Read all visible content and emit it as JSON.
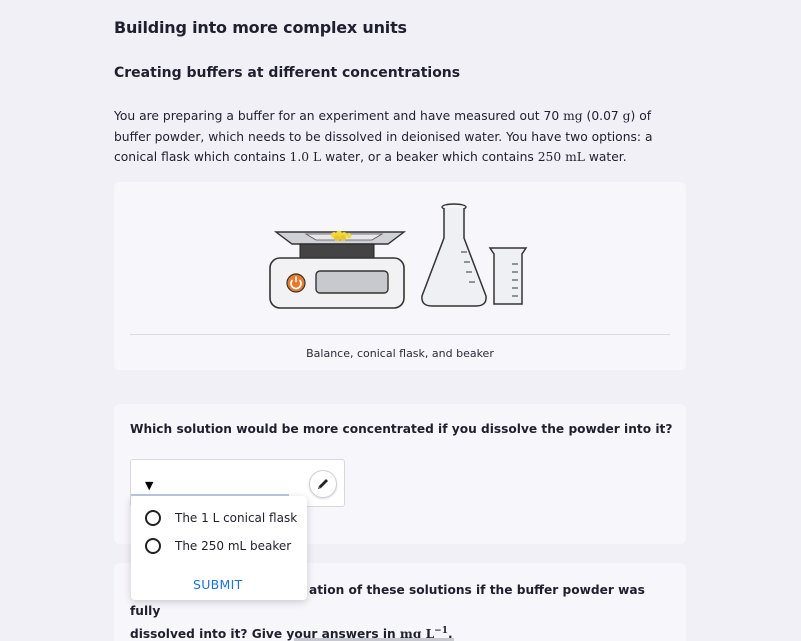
{
  "headings": {
    "title": "Building into more complex units",
    "subtitle": "Creating buffers at different concentrations"
  },
  "intro": {
    "p1": "You are preparing a buffer for an experiment and have measured out 70 ",
    "m1": "mg",
    "p2": " (0.07 ",
    "m2": "g",
    "p3": ") of buffer powder, which needs to be dissolved in deionised water. You have two options: a conical flask which contains ",
    "m3": "1.0 L",
    "p4": " water, or a beaker which contains ",
    "m4": "250 mL",
    "p5": " water."
  },
  "figure": {
    "caption": "Balance, conical flask, and beaker",
    "icons": [
      "balance-icon",
      "power-icon",
      "conical-flask-icon",
      "beaker-icon"
    ],
    "colors": {
      "power_button": "#e87a2e",
      "powder": "#f2d93a"
    }
  },
  "question1": {
    "text": "Which solution would be more concentrated if you dissolve the powder into it?",
    "select_icon": "caret-down-icon",
    "edit_icon": "pencil-icon"
  },
  "dropdown": {
    "options": [
      "The 1 L conical flask",
      "The 250 mL beaker"
    ],
    "submit_label": "SUBMIT"
  },
  "question2": {
    "visible_1": "ation of these solutions if the buffer powder was fully",
    "visible_2": "dissolved into it? Give your answers in ",
    "unit": "mg L",
    "unit_exp": "−1",
    "end": "."
  }
}
